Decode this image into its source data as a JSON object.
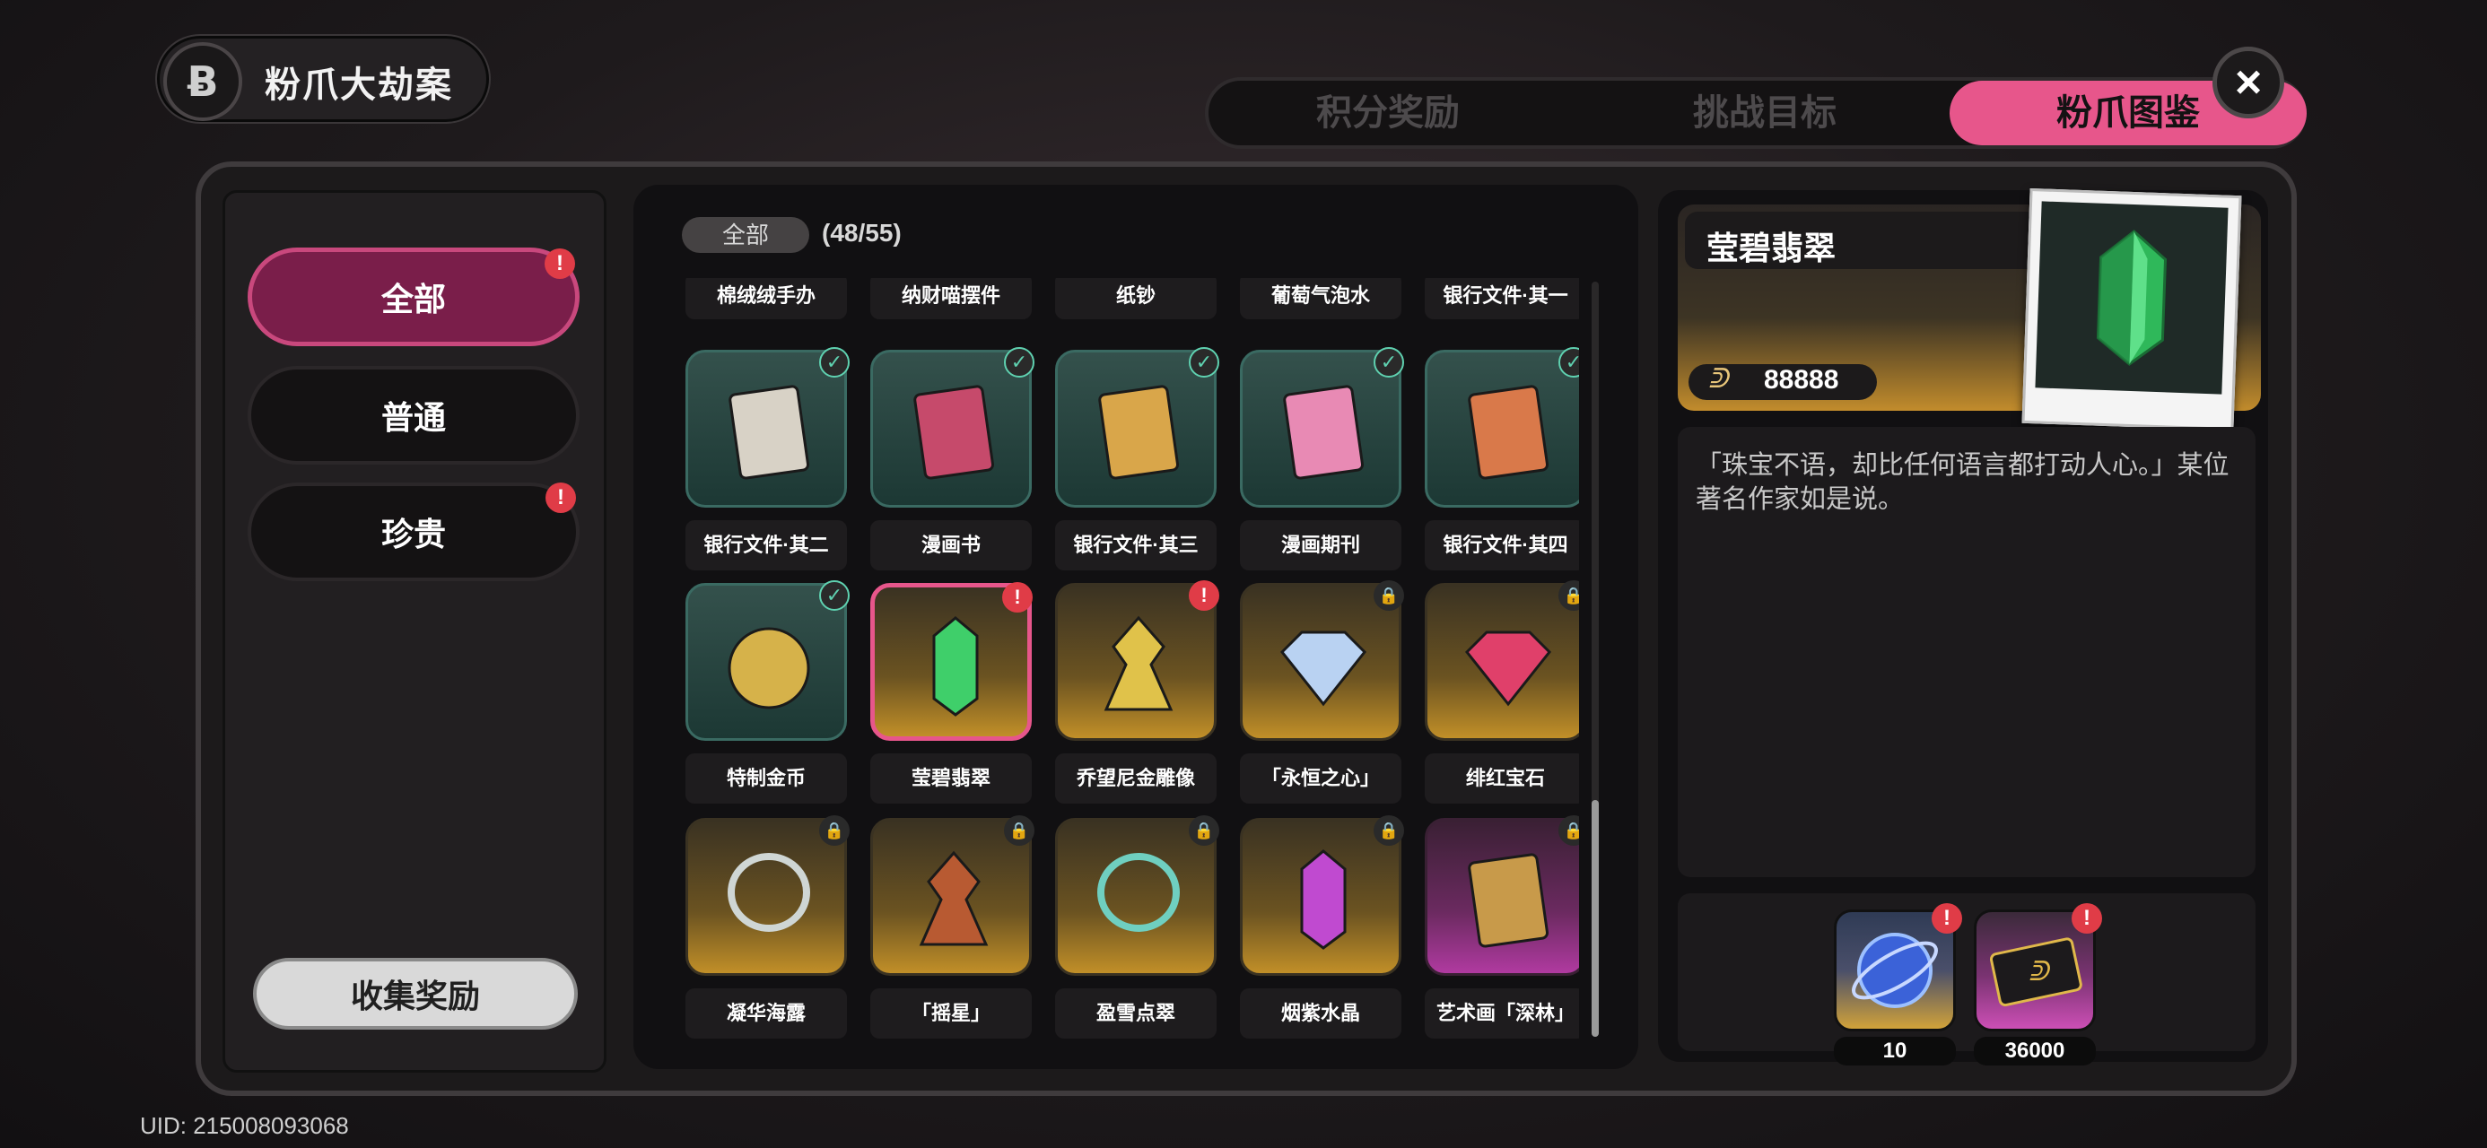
{
  "title": {
    "logo_glyph": "Ƀ",
    "text": "粉爪大劫案"
  },
  "tabs": [
    {
      "label": "积分奖励",
      "active": false
    },
    {
      "label": "挑战目标",
      "active": false
    },
    {
      "label": "粉爪图鉴",
      "active": true
    }
  ],
  "close_icon": "×",
  "categories": [
    {
      "label": "全部",
      "active": true,
      "alert": "!"
    },
    {
      "label": "普通",
      "active": false,
      "alert": ""
    },
    {
      "label": "珍贵",
      "active": false,
      "alert": "!"
    }
  ],
  "collect_button": "收集奖励",
  "filter": {
    "label": "全部",
    "count": "(48/55)"
  },
  "grid": {
    "top_row_labels": [
      "棉绒绒手办",
      "纳财喵摆件",
      "纸钞",
      "葡萄气泡水",
      "银行文件·其一"
    ],
    "items": [
      {
        "label": "银行文件·其二",
        "bg": "teal",
        "status": "check",
        "icon": "documents-icon",
        "color": "#d8d2c6"
      },
      {
        "label": "漫画书",
        "bg": "teal",
        "status": "check",
        "icon": "comic-book-icon",
        "color": "#c64a6b"
      },
      {
        "label": "银行文件·其三",
        "bg": "teal",
        "status": "check",
        "icon": "folder-icon",
        "color": "#d9a64a"
      },
      {
        "label": "漫画期刊",
        "bg": "teal",
        "status": "check",
        "icon": "magazine-icon",
        "color": "#e88ab4"
      },
      {
        "label": "银行文件·其四",
        "bg": "teal",
        "status": "check",
        "icon": "orange-folder-icon",
        "color": "#d9794a"
      },
      {
        "label": "特制金币",
        "bg": "teal",
        "status": "check",
        "icon": "gold-coin-icon",
        "color": "#d6b24a"
      },
      {
        "label": "莹碧翡翠",
        "bg": "gold",
        "status": "alert",
        "icon": "emerald-icon",
        "color": "#3fcf6a",
        "selected": true
      },
      {
        "label": "乔望尼金雕像",
        "bg": "gold",
        "status": "alert",
        "icon": "gold-statue-icon",
        "color": "#e0c24a"
      },
      {
        "label": "「永恒之心」",
        "bg": "gold",
        "status": "lock",
        "icon": "diamond-icon",
        "color": "#b9d2f2"
      },
      {
        "label": "绯红宝石",
        "bg": "gold",
        "status": "lock",
        "icon": "ruby-icon",
        "color": "#e0406a"
      },
      {
        "label": "凝华海露",
        "bg": "gold",
        "status": "lock",
        "icon": "pearl-necklace-icon",
        "color": "#cfd6d4"
      },
      {
        "label": "「摇星」",
        "bg": "gold",
        "status": "lock",
        "icon": "instrument-icon",
        "color": "#b85a32"
      },
      {
        "label": "盈雪点翠",
        "bg": "gold",
        "status": "lock",
        "icon": "jade-necklace-icon",
        "color": "#6fcfc0"
      },
      {
        "label": "烟紫水晶",
        "bg": "gold",
        "status": "lock",
        "icon": "amethyst-icon",
        "color": "#c04ad0"
      },
      {
        "label": "艺术画「深林」",
        "bg": "purple",
        "status": "lock",
        "icon": "painting-icon",
        "color": "#c89a4a"
      }
    ]
  },
  "detail": {
    "name": "莹碧翡翠",
    "price_icon": "ᕲ",
    "price": "88888",
    "description": "「珠宝不语，却比任何语言都打动人心。」某位著名作家如是说。",
    "image_icon": "emerald-icon"
  },
  "rewards": [
    {
      "count": "10",
      "icon": "polychrome-orb-icon",
      "alert": "!"
    },
    {
      "count": "36000",
      "icon": "dennies-card-icon",
      "alert": "!"
    }
  ],
  "uid": "UID: 215008093068",
  "colors": {
    "accent": "#e7568b",
    "selected_category": "#7a1e4a",
    "alert": "#e03c47",
    "check": "#5fd1b0"
  }
}
